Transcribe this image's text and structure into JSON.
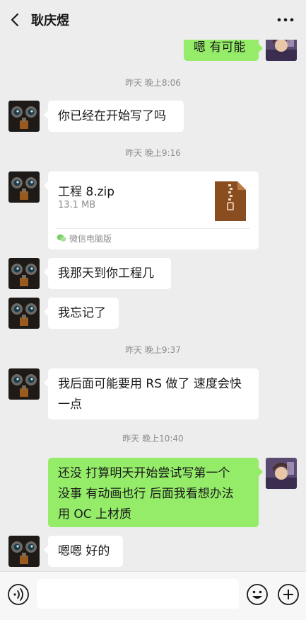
{
  "header": {
    "title": "耿庆煜"
  },
  "messages": {
    "m0": "嗯 有可能",
    "t1": "昨天 晚上8:06",
    "m1": "你已经在开始写了吗",
    "t2": "昨天 晚上9:16",
    "file": {
      "name": "工程 8.zip",
      "size": "13.1 MB",
      "source": "微信电脑版"
    },
    "m3": "我那天到你工程几",
    "m4": "我忘记了",
    "t3": "昨天 晚上9:37",
    "m5a": "我后面可能要用 RS 做了 速度会快",
    "m5b": "一点",
    "t4": "昨天 晚上10:40",
    "m6a": "还没 打算明天开始尝试写第一个",
    "m6b": "没事 有动画也行 后面我看想办法",
    "m6c": "用 OC 上材质",
    "m7": "嗯嗯 好的"
  },
  "colors": {
    "bubble_self": "#95ec69",
    "bubble_other": "#ffffff",
    "background": "#ededed"
  },
  "icons": [
    "back-arrow-icon",
    "more-icon",
    "zip-file-icon",
    "wechat-pc-icon",
    "voice-icon",
    "emoji-icon",
    "plus-icon"
  ]
}
